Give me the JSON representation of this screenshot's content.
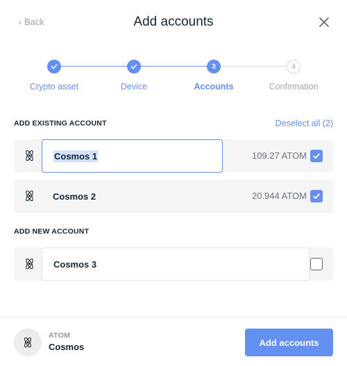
{
  "header": {
    "back_label": "Back",
    "title": "Add accounts"
  },
  "steps": [
    {
      "number": "1",
      "label": "Crypto asset",
      "state": "done"
    },
    {
      "number": "2",
      "label": "Device",
      "state": "done"
    },
    {
      "number": "3",
      "label": "Accounts",
      "state": "active"
    },
    {
      "number": "4",
      "label": "Confirmation",
      "state": "todo"
    }
  ],
  "existing": {
    "title": "Add existing account",
    "deselect_label": "Deselect all (2)",
    "accounts": [
      {
        "name": "Cosmos 1",
        "balance": "109.27 ATOM",
        "checked": true
      },
      {
        "name": "Cosmos 2",
        "balance": "20.944 ATOM",
        "checked": true
      }
    ]
  },
  "new_account": {
    "title": "Add new account",
    "accounts": [
      {
        "name": "Cosmos 3",
        "checked": false
      }
    ]
  },
  "footer": {
    "ticker": "ATOM",
    "currency_name": "Cosmos",
    "cta_label": "Add accounts"
  },
  "colors": {
    "accent": "#6490f1",
    "text": "#142533",
    "muted": "#6b747c"
  },
  "icons": {
    "back": "chevron-left-icon",
    "close": "close-icon",
    "coin": "cosmos-atom-icon",
    "check": "checkmark-icon"
  }
}
